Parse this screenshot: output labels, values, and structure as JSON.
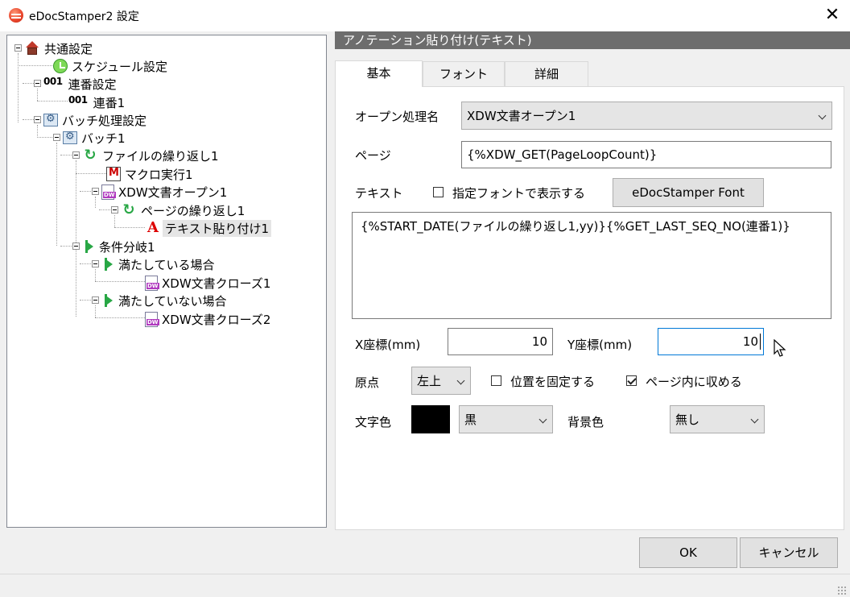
{
  "window": {
    "title": "eDocStamper2 設定",
    "close_glyph": "✕"
  },
  "tree": {
    "items": [
      {
        "label": "共通設定",
        "icon": "house-icon"
      },
      {
        "label": "スケジュール設定",
        "icon": "clock-icon"
      },
      {
        "label": "連番設定",
        "icon": "numbering-icon",
        "prefix": "001"
      },
      {
        "label": "連番1",
        "icon": "numbering-icon",
        "prefix": "001"
      },
      {
        "label": "バッチ処理設定",
        "icon": "batch-icon"
      },
      {
        "label": "バッチ1",
        "icon": "batch-icon"
      },
      {
        "label": "ファイルの繰り返し1",
        "icon": "loop-icon"
      },
      {
        "label": "マクロ実行1",
        "icon": "macro-icon"
      },
      {
        "label": "XDW文書オープン1",
        "icon": "docuworks-icon"
      },
      {
        "label": "ページの繰り返し1",
        "icon": "loop-icon"
      },
      {
        "label": "テキスト貼り付け1",
        "icon": "text-stamp-icon",
        "selected": true
      },
      {
        "label": "条件分岐1",
        "icon": "branch-icon"
      },
      {
        "label": "満たしている場合",
        "icon": "branch-icon"
      },
      {
        "label": "XDW文書クローズ1",
        "icon": "docuworks-icon"
      },
      {
        "label": "満たしていない場合",
        "icon": "branch-icon"
      },
      {
        "label": "XDW文書クローズ2",
        "icon": "docuworks-icon"
      }
    ]
  },
  "panel": {
    "header": "アノテーション貼り付け(テキスト)",
    "tabs": [
      {
        "label": "基本",
        "active": true
      },
      {
        "label": "フォント",
        "active": false
      },
      {
        "label": "詳細",
        "active": false
      }
    ]
  },
  "form": {
    "open_process": {
      "label": "オープン処理名",
      "value": "XDW文書オープン1"
    },
    "page": {
      "label": "ページ",
      "value": "{%XDW_GET(PageLoopCount)}"
    },
    "text": {
      "label": "テキスト",
      "font_checkbox_label": "指定フォントで表示する",
      "font_checkbox_checked": false,
      "font_button": "eDocStamper Font",
      "value": "{%START_DATE(ファイルの繰り返し1,yy)}{%GET_LAST_SEQ_NO(連番1)}"
    },
    "x": {
      "label": "X座標(mm)",
      "value": "10"
    },
    "y": {
      "label": "Y座標(mm)",
      "value": "10"
    },
    "origin": {
      "label": "原点",
      "value": "左上"
    },
    "fix_position": {
      "label": "位置を固定する",
      "checked": false
    },
    "fit_in_page": {
      "label": "ページ内に収める",
      "checked": true
    },
    "text_color": {
      "label": "文字色",
      "value": "黒",
      "swatch": "#000000"
    },
    "bg_color": {
      "label": "背景色",
      "value": "無し"
    }
  },
  "buttons": {
    "ok": "OK",
    "cancel": "キャンセル"
  },
  "colors": {
    "header_bg": "#6d6d6d",
    "focus_border": "#0078d7",
    "window_bg": "#f0f0f0"
  }
}
